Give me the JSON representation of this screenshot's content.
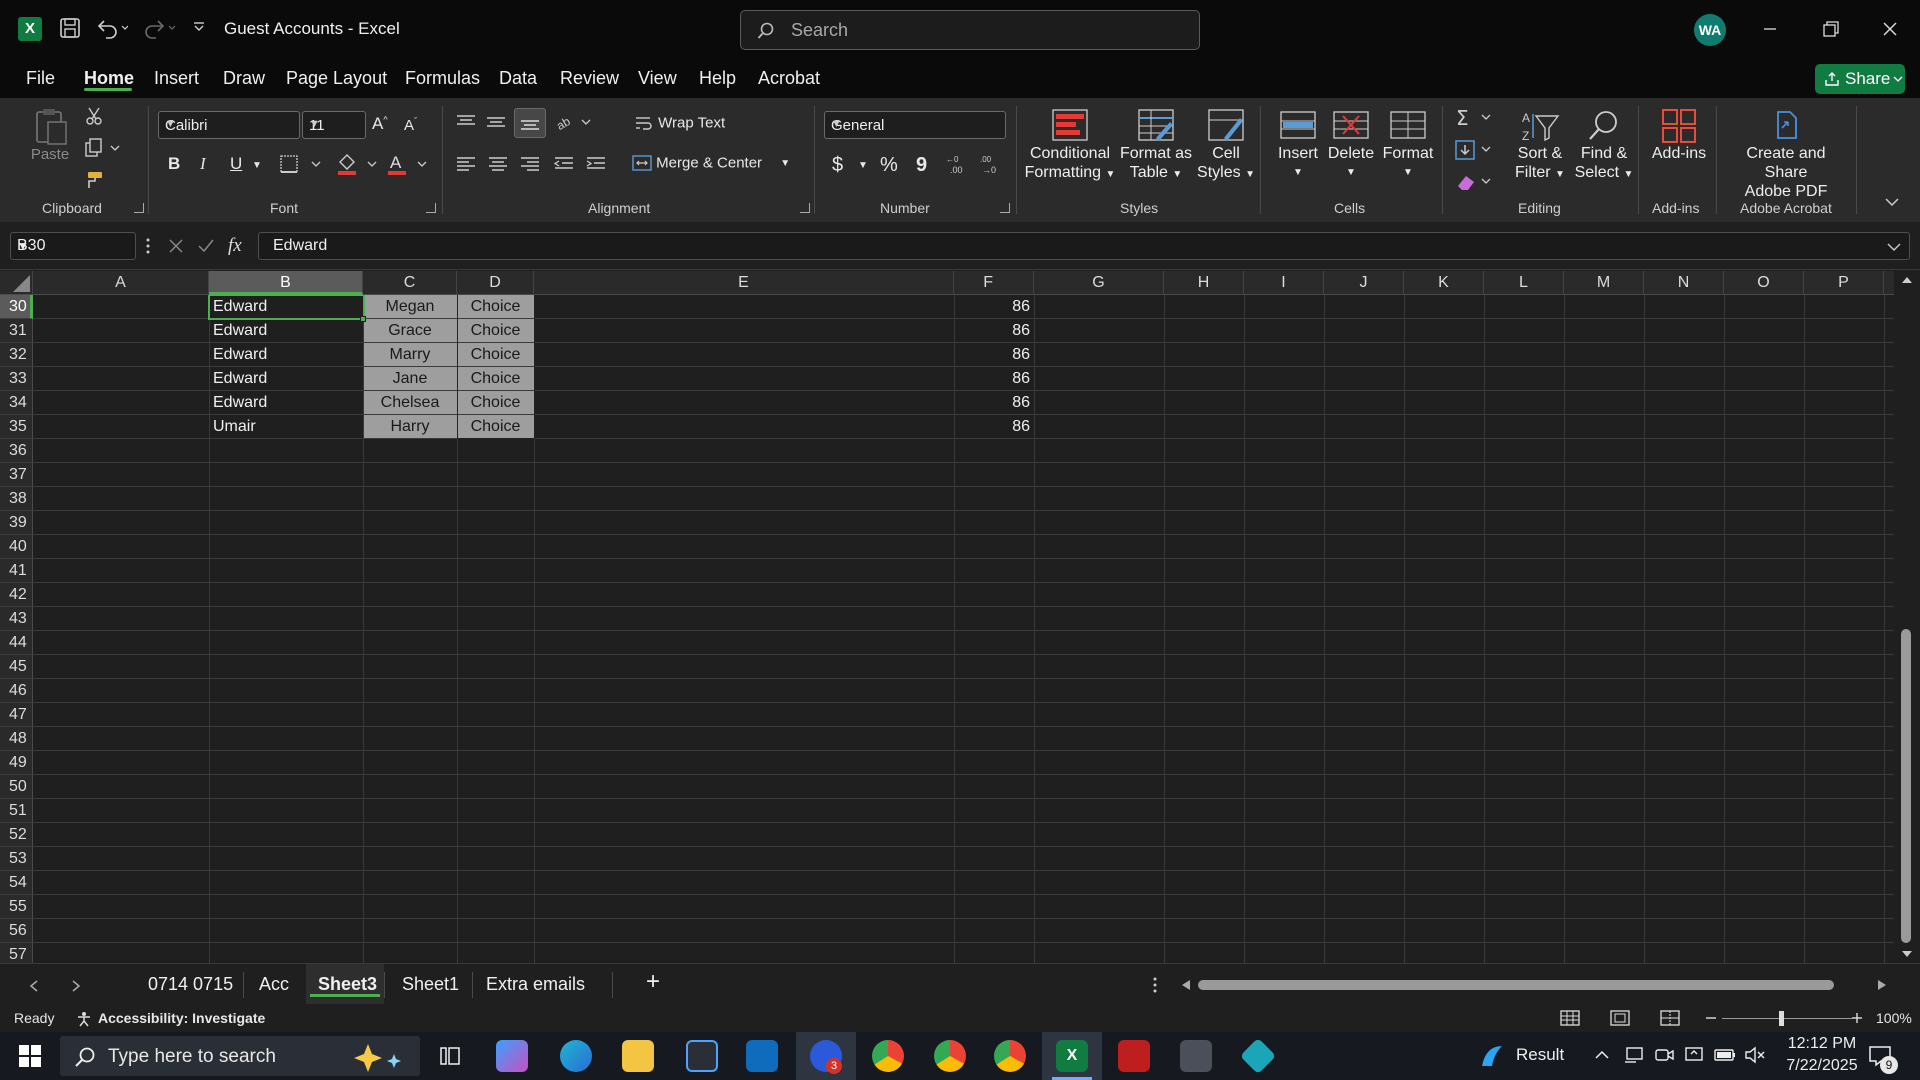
{
  "window": {
    "title": "Guest Accounts  -  Excel",
    "app_icon": "X",
    "search_placeholder": "Search",
    "avatar_initials": "WA"
  },
  "menu_tabs": [
    "File",
    "Home",
    "Insert",
    "Draw",
    "Page Layout",
    "Formulas",
    "Data",
    "Review",
    "View",
    "Help",
    "Acrobat"
  ],
  "share_label": "Share",
  "ribbon": {
    "clipboard": {
      "paste": "Paste",
      "group": "Clipboard"
    },
    "font": {
      "family": "Calibri",
      "size": "11",
      "bold": "B",
      "italic": "I",
      "underline": "U",
      "group": "Font"
    },
    "alignment": {
      "wrap_text": "Wrap Text",
      "merge_center": "Merge & Center",
      "group": "Alignment"
    },
    "number": {
      "format": "General",
      "currency": "$",
      "percent": "%",
      "comma": "9",
      "group": "Number"
    },
    "styles": {
      "conditional": "Conditional",
      "conditional2": "Formatting",
      "format_table": "Format as",
      "format_table2": "Table",
      "cell_styles": "Cell",
      "cell_styles2": "Styles",
      "group": "Styles"
    },
    "cells": {
      "insert": "Insert",
      "delete": "Delete",
      "format": "Format",
      "group": "Cells"
    },
    "editing": {
      "sort": "Sort &",
      "sort2": "Filter",
      "find": "Find &",
      "find2": "Select",
      "group": "Editing"
    },
    "addins": {
      "label": "Add-ins",
      "group": "Add-ins"
    },
    "acrobat": {
      "label": "Create and Share",
      "label2": "Adobe PDF",
      "group": "Adobe Acrobat"
    }
  },
  "formula_bar": {
    "name_box": "B30",
    "fx": "fx",
    "content": "Edward"
  },
  "columns": [
    "A",
    "B",
    "C",
    "D",
    "E",
    "F",
    "G",
    "H",
    "I",
    "J",
    "K",
    "L",
    "M",
    "N",
    "O",
    "P"
  ],
  "rows": [
    "30",
    "31",
    "32",
    "33",
    "34",
    "35",
    "36",
    "37",
    "38",
    "39",
    "40",
    "41",
    "42",
    "43",
    "44",
    "45",
    "46",
    "47",
    "48",
    "49",
    "50",
    "51",
    "52",
    "53",
    "54",
    "55",
    "56",
    "57"
  ],
  "data_rows": [
    {
      "b": "Edward",
      "c": "Megan",
      "d": "Choice",
      "f": "86"
    },
    {
      "b": "Edward",
      "c": "Grace",
      "d": "Choice",
      "f": "86"
    },
    {
      "b": "Edward",
      "c": "Marry",
      "d": "Choice",
      "f": "86"
    },
    {
      "b": "Edward",
      "c": "Jane",
      "d": "Choice",
      "f": "86"
    },
    {
      "b": "Edward",
      "c": "Chelsea",
      "d": "Choice",
      "f": "86"
    },
    {
      "b": "Umair",
      "c": "Harry",
      "d": "Choice",
      "f": "86"
    }
  ],
  "sheets": [
    "0714 0715",
    "Acc",
    "Sheet3",
    "Sheet1",
    "Extra emails"
  ],
  "add_sheet": "+",
  "status": {
    "ready": "Ready",
    "accessibility": "Accessibility: Investigate",
    "zoom": "100%"
  },
  "taskbar": {
    "search_placeholder": "Type here to search",
    "weather": "Result",
    "time": "12:12 PM",
    "date": "7/22/2025",
    "notifications": "9",
    "badge": "3"
  },
  "colors": {
    "accent": "#4caf50",
    "excel_green": "#107c41",
    "cell_fill": "#9e9e9e"
  }
}
